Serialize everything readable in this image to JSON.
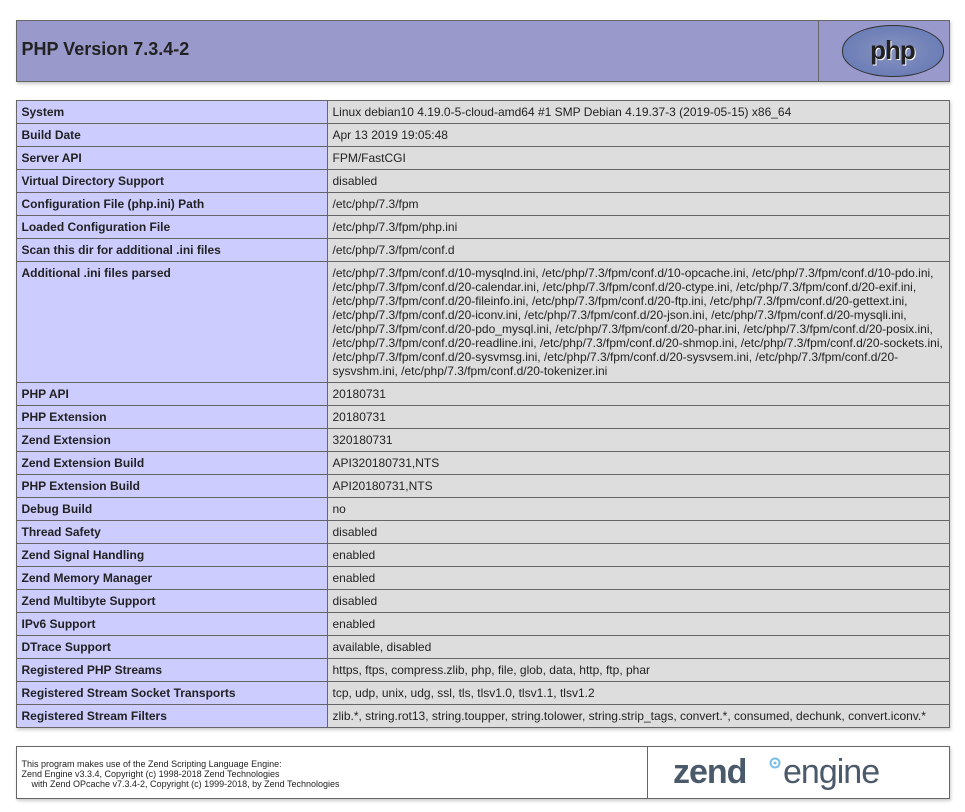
{
  "header": {
    "title": "PHP Version 7.3.4-2",
    "logo_alt": "php"
  },
  "rows": [
    {
      "k": "System",
      "v": "Linux debian10 4.19.0-5-cloud-amd64 #1 SMP Debian 4.19.37-3 (2019-05-15) x86_64"
    },
    {
      "k": "Build Date",
      "v": "Apr 13 2019 19:05:48"
    },
    {
      "k": "Server API",
      "v": "FPM/FastCGI"
    },
    {
      "k": "Virtual Directory Support",
      "v": "disabled"
    },
    {
      "k": "Configuration File (php.ini) Path",
      "v": "/etc/php/7.3/fpm"
    },
    {
      "k": "Loaded Configuration File",
      "v": "/etc/php/7.3/fpm/php.ini"
    },
    {
      "k": "Scan this dir for additional .ini files",
      "v": "/etc/php/7.3/fpm/conf.d"
    },
    {
      "k": "Additional .ini files parsed",
      "v": "/etc/php/7.3/fpm/conf.d/10-mysqlnd.ini, /etc/php/7.3/fpm/conf.d/10-opcache.ini, /etc/php/7.3/fpm/conf.d/10-pdo.ini, /etc/php/7.3/fpm/conf.d/20-calendar.ini, /etc/php/7.3/fpm/conf.d/20-ctype.ini, /etc/php/7.3/fpm/conf.d/20-exif.ini, /etc/php/7.3/fpm/conf.d/20-fileinfo.ini, /etc/php/7.3/fpm/conf.d/20-ftp.ini, /etc/php/7.3/fpm/conf.d/20-gettext.ini, /etc/php/7.3/fpm/conf.d/20-iconv.ini, /etc/php/7.3/fpm/conf.d/20-json.ini, /etc/php/7.3/fpm/conf.d/20-mysqli.ini, /etc/php/7.3/fpm/conf.d/20-pdo_mysql.ini, /etc/php/7.3/fpm/conf.d/20-phar.ini, /etc/php/7.3/fpm/conf.d/20-posix.ini, /etc/php/7.3/fpm/conf.d/20-readline.ini, /etc/php/7.3/fpm/conf.d/20-shmop.ini, /etc/php/7.3/fpm/conf.d/20-sockets.ini, /etc/php/7.3/fpm/conf.d/20-sysvmsg.ini, /etc/php/7.3/fpm/conf.d/20-sysvsem.ini, /etc/php/7.3/fpm/conf.d/20-sysvshm.ini, /etc/php/7.3/fpm/conf.d/20-tokenizer.ini"
    },
    {
      "k": "PHP API",
      "v": "20180731"
    },
    {
      "k": "PHP Extension",
      "v": "20180731"
    },
    {
      "k": "Zend Extension",
      "v": "320180731"
    },
    {
      "k": "Zend Extension Build",
      "v": "API320180731,NTS"
    },
    {
      "k": "PHP Extension Build",
      "v": "API20180731,NTS"
    },
    {
      "k": "Debug Build",
      "v": "no"
    },
    {
      "k": "Thread Safety",
      "v": "disabled"
    },
    {
      "k": "Zend Signal Handling",
      "v": "enabled"
    },
    {
      "k": "Zend Memory Manager",
      "v": "enabled"
    },
    {
      "k": "Zend Multibyte Support",
      "v": "disabled"
    },
    {
      "k": "IPv6 Support",
      "v": "enabled"
    },
    {
      "k": "DTrace Support",
      "v": "available, disabled"
    },
    {
      "k": "Registered PHP Streams",
      "v": "https, ftps, compress.zlib, php, file, glob, data, http, ftp, phar"
    },
    {
      "k": "Registered Stream Socket Transports",
      "v": "tcp, udp, unix, udg, ssl, tls, tlsv1.0, tlsv1.1, tlsv1.2"
    },
    {
      "k": "Registered Stream Filters",
      "v": "zlib.*, string.rot13, string.toupper, string.tolower, string.strip_tags, convert.*, consumed, dechunk, convert.iconv.*"
    }
  ],
  "zend": {
    "line1": "This program makes use of the Zend Scripting Language Engine:",
    "line2": "Zend Engine v3.3.4, Copyright (c) 1998-2018 Zend Technologies",
    "line3_prefix": "    with Zend OPcache v7.3.4-2, Copyright (c) 1999-2018, by Zend Technologies",
    "logo_text_1": "zend",
    "logo_text_2": "engine"
  }
}
